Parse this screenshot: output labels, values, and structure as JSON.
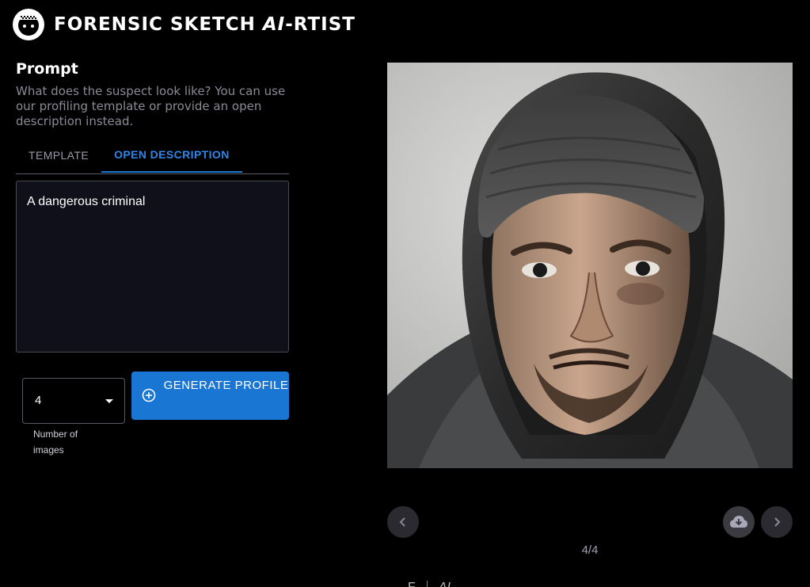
{
  "header": {
    "logo_icon": "sketch-face-logo-icon",
    "title_prefix": "FORENSIC SKETCH ",
    "title_ai": "AI",
    "title_suffix": "-RTIST"
  },
  "prompt": {
    "heading": "Prompt",
    "description": "What does the suspect look like? You can use our profiling template or provide an open description instead."
  },
  "tabs": [
    {
      "label": "TEMPLATE",
      "active": false
    },
    {
      "label": "OPEN DESCRIPTION",
      "active": true
    }
  ],
  "description_input": {
    "value": "A dangerous criminal"
  },
  "image_count": {
    "value": "4",
    "helper": "Number of images",
    "icon": "caret-down-icon"
  },
  "generate_button": {
    "label": "GENERATE PROFILE",
    "icon": "add-circle-icon"
  },
  "carousel": {
    "counter": "4/4",
    "prev_icon": "chevron-left-icon",
    "download_icon": "cloud-download-icon",
    "next_icon": "chevron-right-icon"
  },
  "footer": {
    "left_text": "F",
    "right_text": "AI"
  },
  "colors": {
    "accent": "#1976d2",
    "tab_active": "#2f86e8",
    "background": "#000000",
    "input_bg": "#10101a"
  }
}
